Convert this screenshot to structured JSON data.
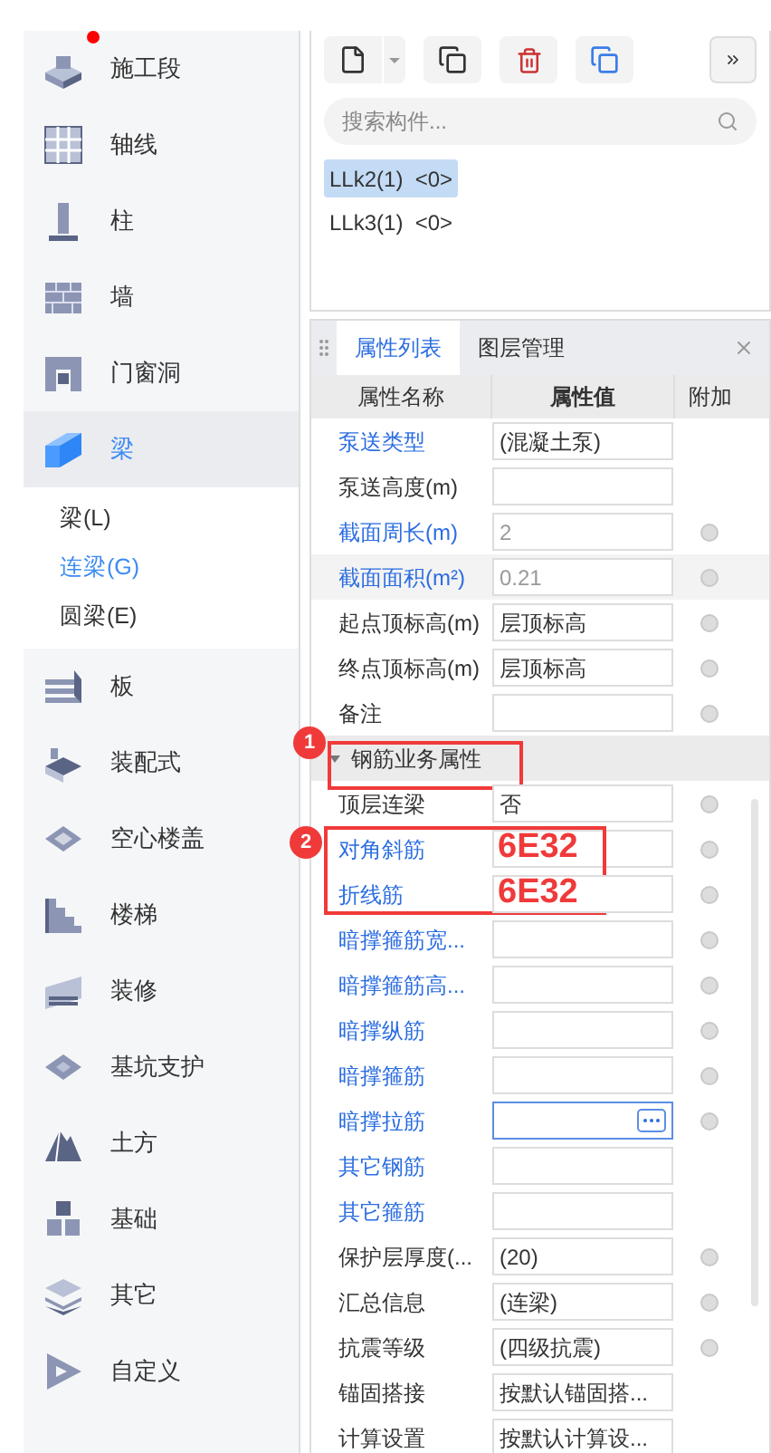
{
  "sidebar": {
    "items": [
      {
        "label": "施工段",
        "selected": false,
        "unread": true
      },
      {
        "label": "轴线",
        "selected": false,
        "unread": false
      },
      {
        "label": "柱",
        "selected": false,
        "unread": false
      },
      {
        "label": "墙",
        "selected": false,
        "unread": false
      },
      {
        "label": "门窗洞",
        "selected": false,
        "unread": false
      },
      {
        "label": "梁",
        "selected": true,
        "unread": false,
        "children": [
          {
            "label": "梁(L)",
            "selected": false
          },
          {
            "label": "连梁(G)",
            "selected": true
          },
          {
            "label": "圆梁(E)",
            "selected": false
          }
        ]
      },
      {
        "label": "板",
        "selected": false,
        "unread": false
      },
      {
        "label": "装配式",
        "selected": false,
        "unread": false
      },
      {
        "label": "空心楼盖",
        "selected": false,
        "unread": false
      },
      {
        "label": "楼梯",
        "selected": false,
        "unread": false
      },
      {
        "label": "装修",
        "selected": false,
        "unread": false
      },
      {
        "label": "基坑支护",
        "selected": false,
        "unread": false
      },
      {
        "label": "土方",
        "selected": false,
        "unread": false
      },
      {
        "label": "基础",
        "selected": false,
        "unread": false
      },
      {
        "label": "其它",
        "selected": false,
        "unread": false
      },
      {
        "label": "自定义",
        "selected": false,
        "unread": false
      }
    ]
  },
  "component_list": {
    "search": {
      "placeholder": "搜索构件..."
    },
    "items": [
      {
        "name": "LLk2(1)",
        "count": "<0>",
        "selected": true
      },
      {
        "name": "LLk3(1)",
        "count": "<0>",
        "selected": false
      }
    ]
  },
  "properties": {
    "tabs": [
      {
        "label": "属性列表",
        "selected": true
      },
      {
        "label": "图层管理",
        "selected": false
      }
    ],
    "columns": [
      "属性名称",
      "属性值",
      "附加"
    ],
    "rows": [
      {
        "kind": "field",
        "name": "泵送类型",
        "value": "(混凝土泵)",
        "linked": true,
        "readonly": false,
        "attach": false,
        "highlighted": false,
        "editing": false
      },
      {
        "kind": "field",
        "name": "泵送高度(m)",
        "linked": false,
        "attach": false,
        "highlighted": false,
        "editing": false
      },
      {
        "kind": "field",
        "name": "截面周长(m)",
        "value": "2",
        "linked": true,
        "readonly": true,
        "attach": true,
        "highlighted": false,
        "editing": false
      },
      {
        "kind": "field",
        "name": "截面面积(m²)",
        "value": "0.21",
        "linked": true,
        "readonly": true,
        "attach": true,
        "highlighted": true,
        "editing": false
      },
      {
        "kind": "field",
        "name": "起点顶标高(m)",
        "value": "层顶标高",
        "linked": false,
        "readonly": false,
        "attach": true,
        "highlighted": false,
        "editing": false
      },
      {
        "kind": "field",
        "name": "终点顶标高(m)",
        "value": "层顶标高",
        "linked": false,
        "readonly": false,
        "attach": true,
        "highlighted": false,
        "editing": false
      },
      {
        "kind": "field",
        "name": "备注",
        "linked": false,
        "attach": true,
        "highlighted": false,
        "editing": false
      },
      {
        "kind": "group",
        "name": "钢筋业务属性",
        "expanded": true,
        "callout": "1"
      },
      {
        "kind": "field",
        "name": "顶层连梁",
        "value": "否",
        "linked": false,
        "readonly": false,
        "attach": true,
        "highlighted": false,
        "editing": false
      },
      {
        "kind": "field",
        "name": "对角斜筋",
        "note": "6E32",
        "callout": "2",
        "linked": true,
        "attach": true,
        "highlighted": false,
        "editing": false
      },
      {
        "kind": "field",
        "name": "折线筋",
        "note": "6E32",
        "linked": true,
        "attach": true,
        "highlighted": false,
        "editing": false
      },
      {
        "kind": "field",
        "name": "暗撑箍筋宽...",
        "linked": true,
        "attach": true,
        "highlighted": false,
        "editing": false
      },
      {
        "kind": "field",
        "name": "暗撑箍筋高...",
        "linked": true,
        "attach": true,
        "highlighted": false,
        "editing": false
      },
      {
        "kind": "field",
        "name": "暗撑纵筋",
        "linked": true,
        "attach": true,
        "highlighted": false,
        "editing": false
      },
      {
        "kind": "field",
        "name": "暗撑箍筋",
        "linked": true,
        "attach": true,
        "highlighted": false,
        "editing": false
      },
      {
        "kind": "field",
        "name": "暗撑拉筋",
        "linked": true,
        "attach": true,
        "highlighted": false,
        "editing": true
      },
      {
        "kind": "field",
        "name": "其它钢筋",
        "linked": true,
        "attach": false,
        "highlighted": false,
        "editing": false
      },
      {
        "kind": "field",
        "name": "其它箍筋",
        "linked": true,
        "attach": false,
        "highlighted": false,
        "editing": false
      },
      {
        "kind": "field",
        "name": "保护层厚度(...",
        "value": "(20)",
        "linked": false,
        "readonly": false,
        "attach": true,
        "highlighted": false,
        "editing": false
      },
      {
        "kind": "field",
        "name": "汇总信息",
        "value": "(连梁)",
        "linked": false,
        "readonly": false,
        "attach": true,
        "highlighted": false,
        "editing": false
      },
      {
        "kind": "field",
        "name": "抗震等级",
        "value": "(四级抗震)",
        "linked": false,
        "readonly": false,
        "attach": true,
        "highlighted": false,
        "editing": false
      },
      {
        "kind": "field",
        "name": "锚固搭接",
        "value": "按默认锚固搭...",
        "linked": false,
        "readonly": false,
        "attach": false,
        "highlighted": false,
        "editing": false
      },
      {
        "kind": "field",
        "name": "计算设置",
        "value": "按默认计算设...",
        "linked": false,
        "readonly": false,
        "attach": false,
        "highlighted": false,
        "editing": false
      }
    ]
  }
}
